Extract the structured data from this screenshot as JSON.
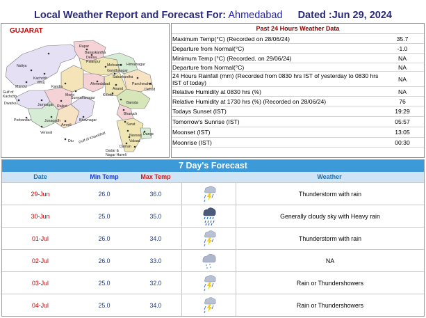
{
  "header": {
    "label": "Local Weather Report and Forecast For:",
    "city": "Ahmedabad",
    "dated": "Dated :Jun 29, 2024"
  },
  "map": {
    "title": "GUJARAT",
    "places": [
      "Rapar",
      "Banaskantha",
      "Deesa",
      "Palanpur",
      "Naliya",
      "Kachchh Bhuj",
      "Mandvi",
      "Mehsana",
      "Gandhinagar",
      "Himatnagar",
      "Ahmedabad",
      "Sabarkantha",
      "Anand",
      "Panchmahal",
      "Dahod",
      "Kheda",
      "Kandla",
      "Gulf of Kachchh",
      "Dwarka",
      "Jamnagar",
      "Morbi",
      "Rajkot",
      "Surendranagar",
      "Baroda",
      "Bharuch",
      "Amreli",
      "Bhavnagar",
      "Surat",
      "Porbandar",
      "Veraval",
      "Junagadh",
      "Navsari",
      "Valsad",
      "Dangs",
      "Diu",
      "Gulf of Khambhat",
      "Daman",
      "Dadar & Nagar Haveli"
    ]
  },
  "past24": {
    "title": "Past 24 Hours Weather Data",
    "rows": [
      {
        "label": "Maximum Temp(°C) (Recorded on 28/06/24)",
        "value": "35.7"
      },
      {
        "label": "Departure from Normal(°C)",
        "value": "-1.0"
      },
      {
        "label": "Minimum Temp (°C) (Recorded. on 29/06/24)",
        "value": "NA"
      },
      {
        "label": "Departure from Normal(°C)",
        "value": "NA"
      },
      {
        "label": "24 Hours Rainfall (mm) (Recorded from 0830 hrs IST of yesterday to 0830 hrs IST of today)",
        "value": "NA"
      },
      {
        "label": "Relative Humidity at 0830 hrs (%)",
        "value": "NA"
      },
      {
        "label": "Relative Humidity at 1730 hrs (%) (Recorded on 28/06/24)",
        "value": "76"
      },
      {
        "label": "Todays Sunset (IST)",
        "value": "19:29"
      },
      {
        "label": "Tomorrow's Sunrise (IST)",
        "value": "05:57"
      },
      {
        "label": "Moonset (IST)",
        "value": "13:05"
      },
      {
        "label": "Moonrise (IST)",
        "value": "00:30"
      }
    ]
  },
  "forecast": {
    "title": "7 Day's Forecast",
    "headers": {
      "date": "Date",
      "min": "Min Temp",
      "max": "Max Temp",
      "weather": "Weather"
    },
    "header_colors": {
      "date": "#1a6fb5",
      "min": "#1a3fd0",
      "max": "#d01818",
      "weather": "#1a6fb5"
    },
    "rows": [
      {
        "date": "29-Jun",
        "min": "26.0",
        "max": "36.0",
        "icon": "thunderstorm-icon",
        "weather": "Thunderstorm with rain"
      },
      {
        "date": "30-Jun",
        "min": "25.0",
        "max": "35.0",
        "icon": "heavy-rain-cloud-icon",
        "weather": "Generally cloudy sky with Heavy rain"
      },
      {
        "date": "01-Jul",
        "min": "26.0",
        "max": "34.0",
        "icon": "thunderstorm-icon",
        "weather": "Thunderstorm with rain"
      },
      {
        "date": "02-Jul",
        "min": "26.0",
        "max": "33.0",
        "icon": "light-rain-cloud-icon",
        "weather": "NA"
      },
      {
        "date": "03-Jul",
        "min": "25.0",
        "max": "32.0",
        "icon": "thunderstorm-icon",
        "weather": "Rain or Thundershowers"
      },
      {
        "date": "04-Jul",
        "min": "25.0",
        "max": "34.0",
        "icon": "thunderstorm-icon",
        "weather": "Rain or Thundershowers"
      }
    ]
  }
}
